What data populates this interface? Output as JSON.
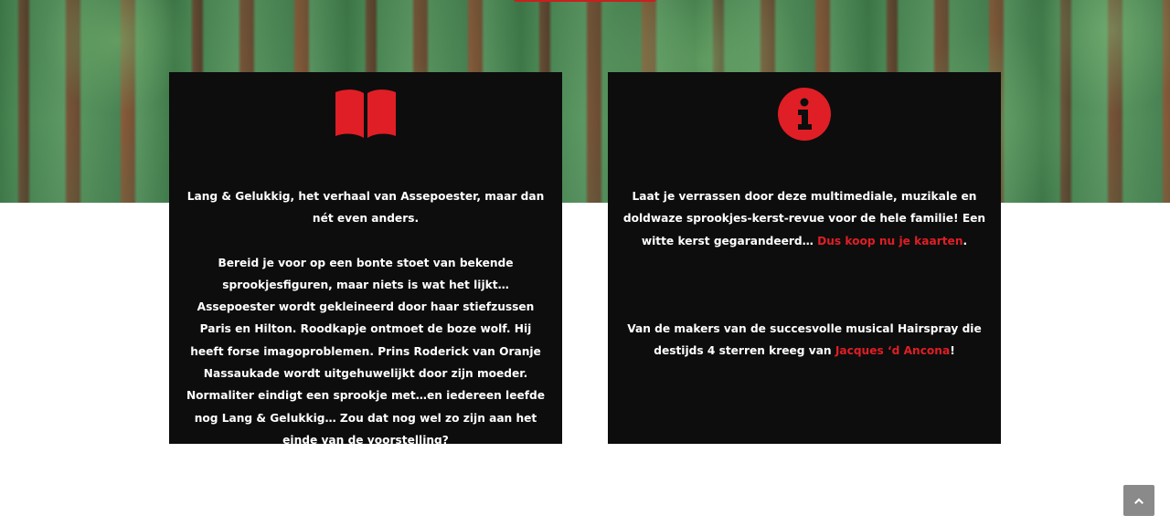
{
  "colors": {
    "card_bg": "#0d0d0d",
    "accent": "#e01e25",
    "scroll_button": "#8a8a8a"
  },
  "card_left": {
    "icon": "book-open-icon",
    "intro": "Lang & Gelukkig, het verhaal van Assepoester, maar dan nét even anders.",
    "body": "Bereid je voor op een bonte stoet van bekende sprookjesfiguren, maar niets is wat het lijkt… Assepoester wordt gekleineerd door haar stiefzussen Paris en Hilton. Roodkapje ontmoet de boze wolf. Hij heeft forse imagoproblemen. Prins Roderick van Oranje Nassaukade wordt uitgehuwelijkt door zijn moeder. Normaliter eindigt een sprookje met…en iedereen leefde nog Lang & Gelukkig… Zou dat nog wel zo zijn aan het einde van de voorstelling?"
  },
  "card_right": {
    "icon": "info-circle-icon",
    "intro_text": "Laat je verrassen door deze multimediale, muzikale en doldwaze sprookjes-kerst-revue voor de hele familie! Een witte kerst gegarandeerd… ",
    "intro_link": "Dus koop nu je kaarten",
    "intro_end": ".",
    "makers_text": "Van de makers van de succesvolle musical Hairspray die destijds 4 sterren kreeg van ",
    "makers_link": "Jacques ‘d Ancona",
    "makers_end": "!"
  },
  "scroll_top": {
    "icon": "chevron-up-icon"
  }
}
